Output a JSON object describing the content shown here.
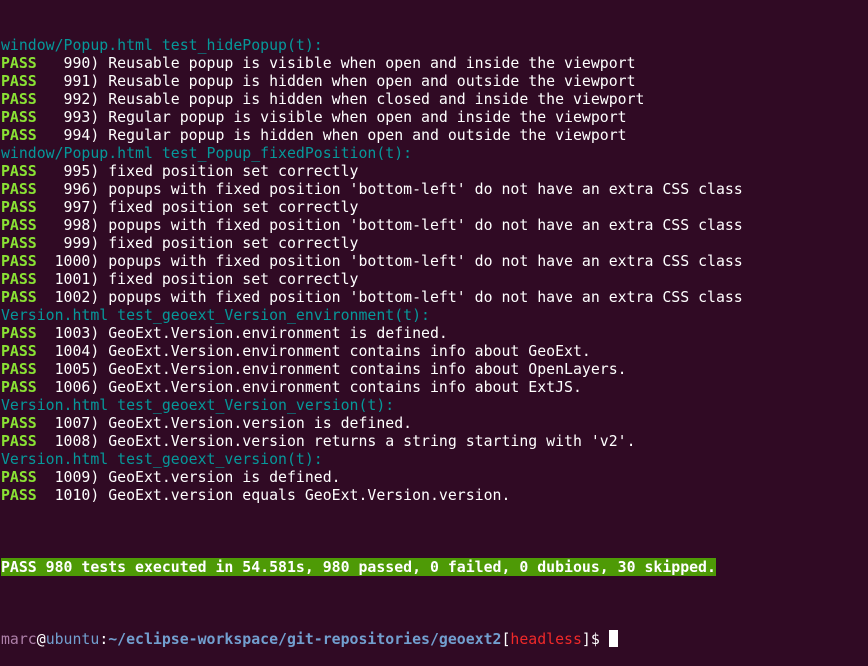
{
  "terminal": {
    "lines": [
      {
        "kind": "group",
        "text": "window/Popup.html test_hidePopup(t):"
      },
      {
        "kind": "test",
        "status": "PASS",
        "text": "   990) Reusable popup is visible when open and inside the viewport"
      },
      {
        "kind": "test",
        "status": "PASS",
        "text": "   991) Reusable popup is hidden when open and outside the viewport"
      },
      {
        "kind": "test",
        "status": "PASS",
        "text": "   992) Reusable popup is hidden when closed and inside the viewport"
      },
      {
        "kind": "test",
        "status": "PASS",
        "text": "   993) Regular popup is visible when open and inside the viewport"
      },
      {
        "kind": "test",
        "status": "PASS",
        "text": "   994) Regular popup is hidden when open and outside the viewport"
      },
      {
        "kind": "group",
        "text": "window/Popup.html test_Popup_fixedPosition(t):"
      },
      {
        "kind": "test",
        "status": "PASS",
        "text": "   995) fixed position set correctly"
      },
      {
        "kind": "test",
        "status": "PASS",
        "text": "   996) popups with fixed position 'bottom-left' do not have an extra CSS class"
      },
      {
        "kind": "test",
        "status": "PASS",
        "text": "   997) fixed position set correctly"
      },
      {
        "kind": "test",
        "status": "PASS",
        "text": "   998) popups with fixed position 'bottom-left' do not have an extra CSS class"
      },
      {
        "kind": "test",
        "status": "PASS",
        "text": "   999) fixed position set correctly"
      },
      {
        "kind": "test",
        "status": "PASS",
        "text": "  1000) popups with fixed position 'bottom-left' do not have an extra CSS class"
      },
      {
        "kind": "test",
        "status": "PASS",
        "text": "  1001) fixed position set correctly"
      },
      {
        "kind": "test",
        "status": "PASS",
        "text": "  1002) popups with fixed position 'bottom-left' do not have an extra CSS class"
      },
      {
        "kind": "group",
        "text": "Version.html test_geoext_Version_environment(t):"
      },
      {
        "kind": "test",
        "status": "PASS",
        "text": "  1003) GeoExt.Version.environment is defined."
      },
      {
        "kind": "test",
        "status": "PASS",
        "text": "  1004) GeoExt.Version.environment contains info about GeoExt."
      },
      {
        "kind": "test",
        "status": "PASS",
        "text": "  1005) GeoExt.Version.environment contains info about OpenLayers."
      },
      {
        "kind": "test",
        "status": "PASS",
        "text": "  1006) GeoExt.Version.environment contains info about ExtJS."
      },
      {
        "kind": "group",
        "text": "Version.html test_geoext_Version_version(t):"
      },
      {
        "kind": "test",
        "status": "PASS",
        "text": "  1007) GeoExt.Version.version is defined."
      },
      {
        "kind": "test",
        "status": "PASS",
        "text": "  1008) GeoExt.Version.version returns a string starting with 'v2'."
      },
      {
        "kind": "group",
        "text": "Version.html test_geoext_version(t):"
      },
      {
        "kind": "test",
        "status": "PASS",
        "text": "  1009) GeoExt.version is defined."
      },
      {
        "kind": "test",
        "status": "PASS",
        "text": "  1010) GeoExt.version equals GeoExt.Version.version."
      }
    ],
    "summary": "PASS 980 tests executed in 54.581s, 980 passed, 0 failed, 0 dubious, 30 skipped.",
    "prompt": {
      "user": "marc",
      "at": "@",
      "host": "ubuntu",
      "colon": ":",
      "path": "~/eclipse-workspace/git-repositories/geoext2",
      "bracket_open": "[",
      "branch": "headless",
      "bracket_close": "]",
      "dollar": "$"
    },
    "colors": {
      "background": "#300a24",
      "group_header": "#06989a",
      "pass": "#8ae234",
      "summary_bg": "#4e9a06",
      "branch": "#ef2929"
    }
  }
}
